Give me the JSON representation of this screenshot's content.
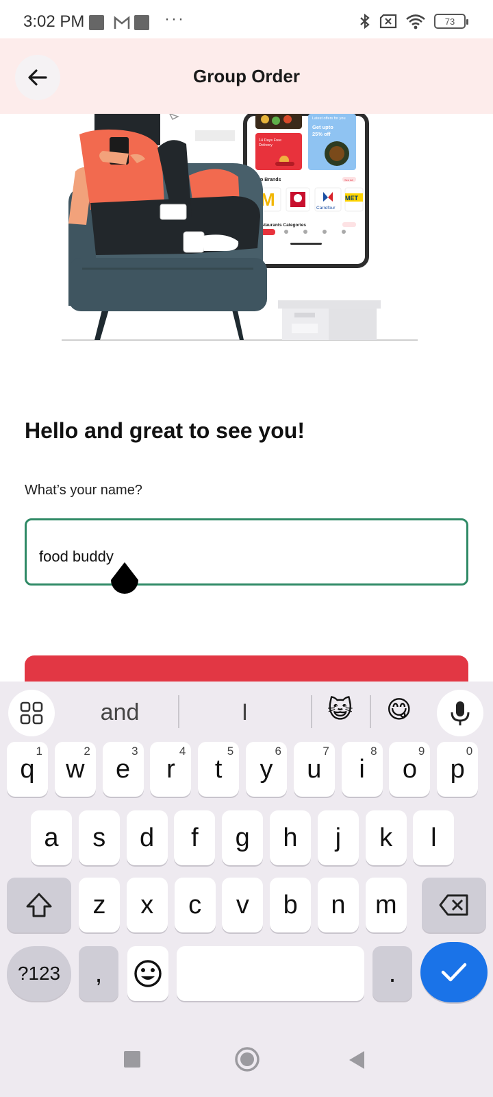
{
  "status_bar": {
    "time": "3:02 PM",
    "dots": "···",
    "battery": "73",
    "icons": [
      "notification-square-icon",
      "gmail-icon",
      "notification-square-icon",
      "bluetooth-icon",
      "no-sim-icon",
      "wifi-icon",
      "battery-icon"
    ]
  },
  "header": {
    "title": "Group Order",
    "back_icon": "arrow-left-icon"
  },
  "illustration": {
    "phone_tiles": {
      "offer_title": "Latest offers for you",
      "offer_text": "Get upto 25% off",
      "delivery_text": "14 Days Free Delivery",
      "top_brands": "Top Brands",
      "see_all": "See All",
      "carrefour": "Carrefour",
      "met": "MET",
      "categories": "Restaurants Categories"
    }
  },
  "main": {
    "greeting": "Hello and great to see you!",
    "name_label": "What’s your name?",
    "name_value": "food buddy",
    "accent_color": "#2f8a66",
    "button_color": "#e23744"
  },
  "keyboard": {
    "suggestions": [
      "and",
      "I"
    ],
    "emoji_suggestions": [
      "😺",
      "😋"
    ],
    "row1": [
      {
        "k": "q",
        "h": "1"
      },
      {
        "k": "w",
        "h": "2"
      },
      {
        "k": "e",
        "h": "3"
      },
      {
        "k": "r",
        "h": "4"
      },
      {
        "k": "t",
        "h": "5"
      },
      {
        "k": "y",
        "h": "6"
      },
      {
        "k": "u",
        "h": "7"
      },
      {
        "k": "i",
        "h": "8"
      },
      {
        "k": "o",
        "h": "9"
      },
      {
        "k": "p",
        "h": "0"
      }
    ],
    "row2": [
      "a",
      "s",
      "d",
      "f",
      "g",
      "h",
      "j",
      "k",
      "l"
    ],
    "row3": [
      "z",
      "x",
      "c",
      "v",
      "b",
      "n",
      "m"
    ],
    "symbols_label": "?123",
    "comma": ",",
    "period": ".",
    "enter_color": "#1a73e8"
  },
  "navbar": {
    "icons": [
      "recents-square-icon",
      "home-circle-icon",
      "back-triangle-icon"
    ]
  }
}
